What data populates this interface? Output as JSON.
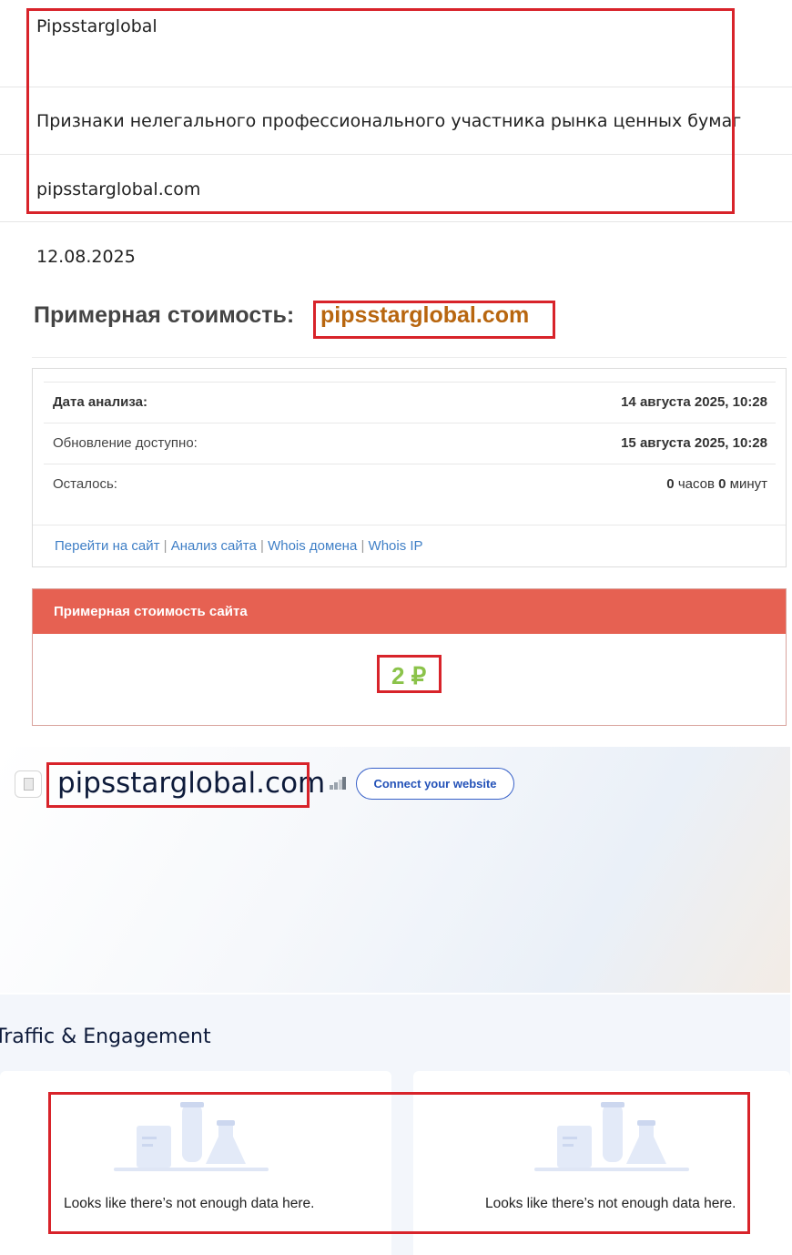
{
  "top_info": {
    "company": "Pipsstarglobal",
    "sign": "Признаки нелегального профессионального участника рынка ценных бумаг",
    "domain": "pipsstarglobal.com",
    "date": "12.08.2025"
  },
  "headline": {
    "label": "Примерная стоимость:",
    "domain": "pipsstarglobal.com"
  },
  "analysis": {
    "rows": [
      {
        "label": "Дата анализа:",
        "value": "14 августа 2025, 10:28"
      },
      {
        "label": "Обновление доступно:",
        "value": "15 августа 2025, 10:28"
      },
      {
        "label": "Осталось:",
        "hours": "0",
        "hours_unit": "часов",
        "minutes": "0",
        "minutes_unit": "минут"
      }
    ],
    "links": [
      "Перейти на сайт",
      "Анализ сайта",
      "Whois домена",
      "Whois IP"
    ],
    "separator": "|"
  },
  "cost": {
    "header": "Примерная стоимость сайта",
    "value": "2 ₽"
  },
  "site_panel": {
    "domain": "pipsstarglobal.com",
    "connect_label": "Connect your website",
    "favicon_icon": "document-icon",
    "rank_icon": "bar-chart-icon"
  },
  "traffic": {
    "title": "Traffic & Engagement",
    "empty_left": "Looks like there’s not enough data here.",
    "empty_right": "Looks like there’s not enough data here."
  },
  "colors": {
    "highlight_border": "#d8232a",
    "headline_domain": "#b8660f",
    "cost_header": "#e66152",
    "cost_value": "#8bc34a",
    "link": "#3f7fc6",
    "button": "#2452b8"
  }
}
